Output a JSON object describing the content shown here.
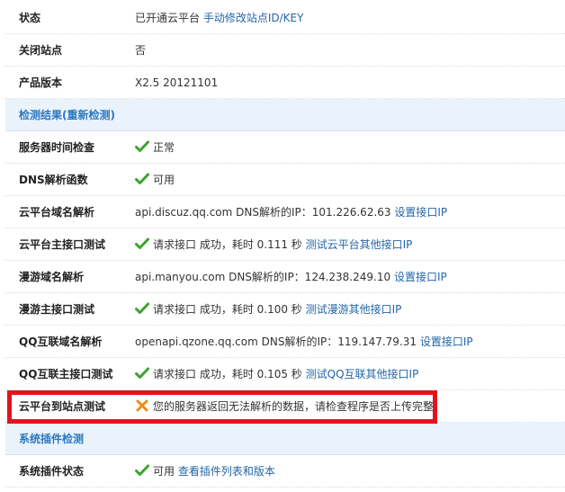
{
  "rows_top": [
    {
      "label": "状态",
      "value": "已开通云平台",
      "link": "手动修改站点ID/KEY"
    },
    {
      "label": "关闭站点",
      "value": "否"
    },
    {
      "label": "产品版本",
      "value": "X2.5 20121101"
    }
  ],
  "section_check": {
    "title": "检测结果(",
    "link": "重新检测",
    "suffix": ")"
  },
  "checks": [
    {
      "label": "服务器时间检查",
      "status": "ok",
      "value": "正常"
    },
    {
      "label": "DNS解析函数",
      "status": "ok",
      "value": "可用"
    },
    {
      "label": "云平台域名解析",
      "status": "none",
      "value": "api.discuz.qq.com DNS解析的IP：101.226.62.63",
      "link": "设置接口IP"
    },
    {
      "label": "云平台主接口测试",
      "status": "ok",
      "value": "请求接口 成功，耗时 0.111 秒",
      "link": "测试云平台其他接口IP"
    },
    {
      "label": "漫游域名解析",
      "status": "none",
      "value": "api.manyou.com DNS解析的IP：124.238.249.10",
      "link": "设置接口IP"
    },
    {
      "label": "漫游主接口测试",
      "status": "ok",
      "value": "请求接口 成功，耗时 0.100 秒",
      "link": "测试漫游其他接口IP"
    },
    {
      "label": "QQ互联域名解析",
      "status": "none",
      "value": "openapi.qzone.qq.com DNS解析的IP：119.147.79.31",
      "link": "设置接口IP"
    },
    {
      "label": "QQ互联主接口测试",
      "status": "ok",
      "value": "请求接口 成功，耗时 0.105 秒",
      "link": "测试QQ互联其他接口IP"
    },
    {
      "label": "云平台到站点测试",
      "status": "error",
      "value": "您的服务器返回无法解析的数据，请检查程序是否上传完整"
    }
  ],
  "section_plugin": {
    "title": "系统插件检测"
  },
  "plugin_rows": [
    {
      "label": "系统插件状态",
      "status": "ok",
      "value": "可用",
      "link": "查看插件列表和版本"
    }
  ],
  "colors": {
    "ok": "#3aa52c",
    "error": "#f08a1c",
    "highlight": "#e0141e",
    "link": "#2366a8"
  }
}
